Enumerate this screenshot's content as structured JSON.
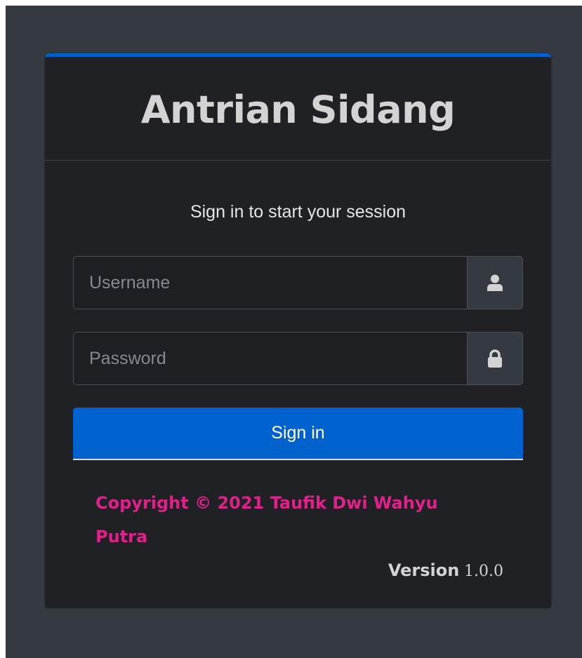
{
  "brand": {
    "title": "Antrian Sidang"
  },
  "login": {
    "message": "Sign in to start your session",
    "username_placeholder": "Username",
    "password_placeholder": "Password",
    "submit_label": "Sign in"
  },
  "icons": {
    "username": "user-icon",
    "password": "lock-icon"
  },
  "footer": {
    "copyright": "Copyright © 2021 Taufik Dwi Wahyu Putra",
    "version_label": "Version",
    "version_number": "1.0.0"
  },
  "colors": {
    "page_background": "#343a40",
    "card_background": "#1f2124",
    "accent": "#0062cc",
    "copyright_text": "#e0218a"
  }
}
